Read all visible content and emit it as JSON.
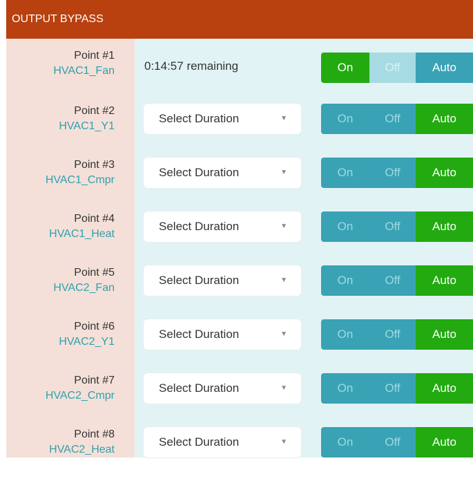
{
  "header": {
    "title": "OUTPUT BYPASS"
  },
  "rows": [
    {
      "point": "Point #1",
      "name": "HVAC1_Fan",
      "status": "0:14:57 remaining",
      "select": "",
      "toggle": {
        "on": "On",
        "off": "Off",
        "auto": "Auto",
        "active": "on"
      }
    },
    {
      "point": "Point #2",
      "name": "HVAC1_Y1",
      "status": "",
      "select": "Select Duration",
      "toggle": {
        "on": "On",
        "off": "Off",
        "auto": "Auto",
        "active": "auto"
      }
    },
    {
      "point": "Point #3",
      "name": "HVAC1_Cmpr",
      "status": "",
      "select": "Select Duration",
      "toggle": {
        "on": "On",
        "off": "Off",
        "auto": "Auto",
        "active": "auto"
      }
    },
    {
      "point": "Point #4",
      "name": "HVAC1_Heat",
      "status": "",
      "select": "Select Duration",
      "toggle": {
        "on": "On",
        "off": "Off",
        "auto": "Auto",
        "active": "auto"
      }
    },
    {
      "point": "Point #5",
      "name": "HVAC2_Fan",
      "status": "",
      "select": "Select Duration",
      "toggle": {
        "on": "On",
        "off": "Off",
        "auto": "Auto",
        "active": "auto"
      }
    },
    {
      "point": "Point #6",
      "name": "HVAC2_Y1",
      "status": "",
      "select": "Select Duration",
      "toggle": {
        "on": "On",
        "off": "Off",
        "auto": "Auto",
        "active": "auto"
      }
    },
    {
      "point": "Point #7",
      "name": "HVAC2_Cmpr",
      "status": "",
      "select": "Select Duration",
      "toggle": {
        "on": "On",
        "off": "Off",
        "auto": "Auto",
        "active": "auto"
      }
    },
    {
      "point": "Point #8",
      "name": "HVAC2_Heat",
      "status": "",
      "select": "Select Duration",
      "toggle": {
        "on": "On",
        "off": "Off",
        "auto": "Auto",
        "active": "auto"
      }
    }
  ],
  "colors": {
    "header_bg": "#b9400f",
    "label_col_bg": "#f4e0d8",
    "content_bg": "#e2f3f5",
    "active_green": "#22aa10",
    "teal": "#3aa2b5",
    "link_teal": "#2f9fb0"
  },
  "icons": {
    "select_chevron": "chevron-down-icon"
  }
}
